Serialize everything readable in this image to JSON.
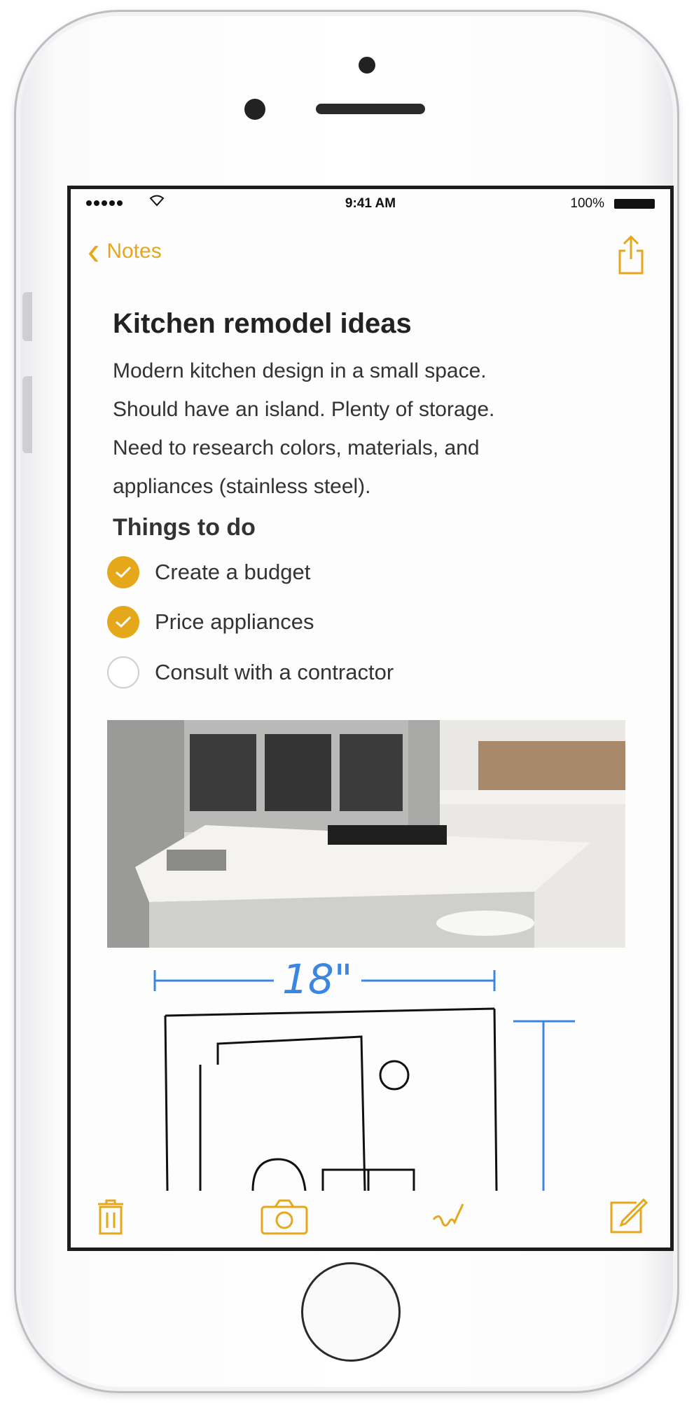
{
  "status_bar": {
    "time": "9:41 AM",
    "battery": "100%"
  },
  "nav": {
    "back_label": "Notes"
  },
  "note": {
    "title": "Kitchen remodel ideas",
    "body": [
      "Modern kitchen design in a small space.",
      "Should have an island. Plenty of storage.",
      "Need to research colors, materials, and",
      "appliances (stainless steel)."
    ],
    "section_title": "Things to do",
    "checklist": [
      {
        "label": "Create a budget",
        "checked": true
      },
      {
        "label": "Price appliances",
        "checked": true
      },
      {
        "label": "Consult with a contractor",
        "checked": false
      }
    ],
    "sketch_label": "18\""
  },
  "colors": {
    "accent": "#e5a81a",
    "ink": "#111111",
    "sketch_blue": "#3a86e0"
  },
  "icons": [
    "back-chevron-icon",
    "share-icon",
    "trash-icon",
    "camera-icon",
    "sketch-icon",
    "compose-icon"
  ]
}
